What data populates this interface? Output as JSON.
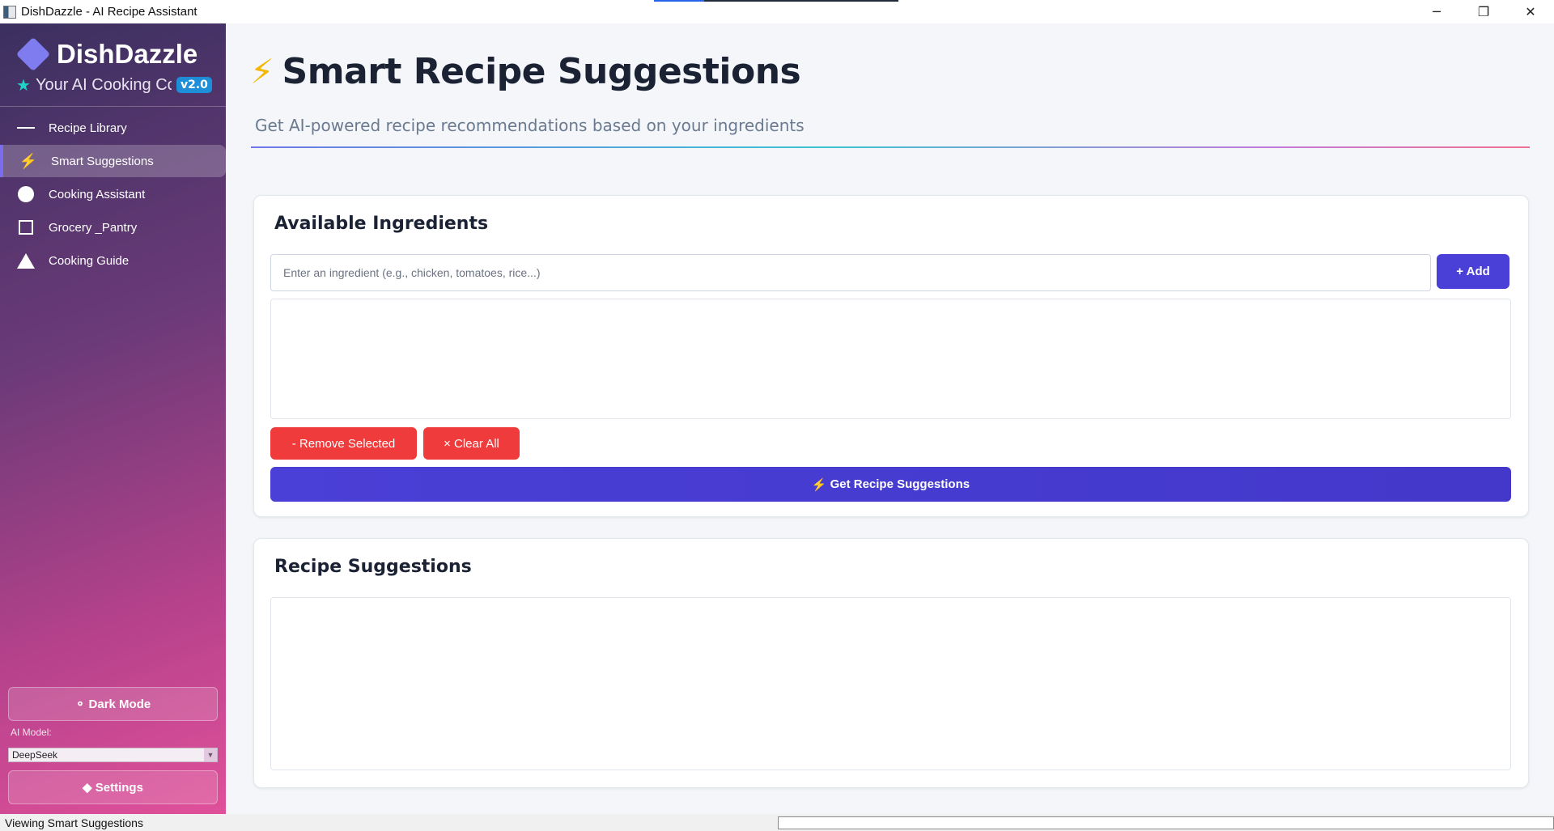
{
  "window": {
    "title": "DishDazzle - AI Recipe Assistant",
    "controls": {
      "minimize": "─",
      "maximize": "❐",
      "close": "✕"
    }
  },
  "sidebar": {
    "brand_name": "DishDazzle",
    "tagline": "Your AI Cooking Companion",
    "version": "v2.0",
    "nav": [
      {
        "label": "Recipe Library",
        "icon": "menu-icon"
      },
      {
        "label": "Smart Suggestions",
        "icon": "lightning-icon",
        "active": true
      },
      {
        "label": "Cooking Assistant",
        "icon": "circle-icon"
      },
      {
        "label": "Grocery _Pantry",
        "icon": "square-icon"
      },
      {
        "label": "Cooking Guide",
        "icon": "triangle-icon"
      }
    ],
    "dark_mode_label": "⚬ Dark Mode",
    "ai_model_label": "AI Model:",
    "ai_model_value": "DeepSeek",
    "settings_label": "◆ Settings"
  },
  "main": {
    "title_icon": "⚡",
    "title": "Smart Recipe Suggestions",
    "subtitle": "Get AI-powered recipe recommendations based on your ingredients",
    "ingredients_card": {
      "heading": "Available Ingredients",
      "input_placeholder": "Enter an ingredient (e.g., chicken, tomatoes, rice...)",
      "input_value": "",
      "add_label": "+ Add",
      "items": [],
      "remove_selected_label": "- Remove Selected",
      "clear_all_label": "× Clear All",
      "get_suggestions_icon": "⚡",
      "get_suggestions_label": "Get Recipe Suggestions"
    },
    "suggestions_card": {
      "heading": "Recipe Suggestions",
      "content": ""
    }
  },
  "status_bar": {
    "message": "Viewing Smart Suggestions"
  },
  "colors": {
    "accent": "#4a3fd6",
    "danger": "#ef3b3b",
    "version_badge": "#1e8ed8",
    "title_bolt": "#f5b700"
  }
}
